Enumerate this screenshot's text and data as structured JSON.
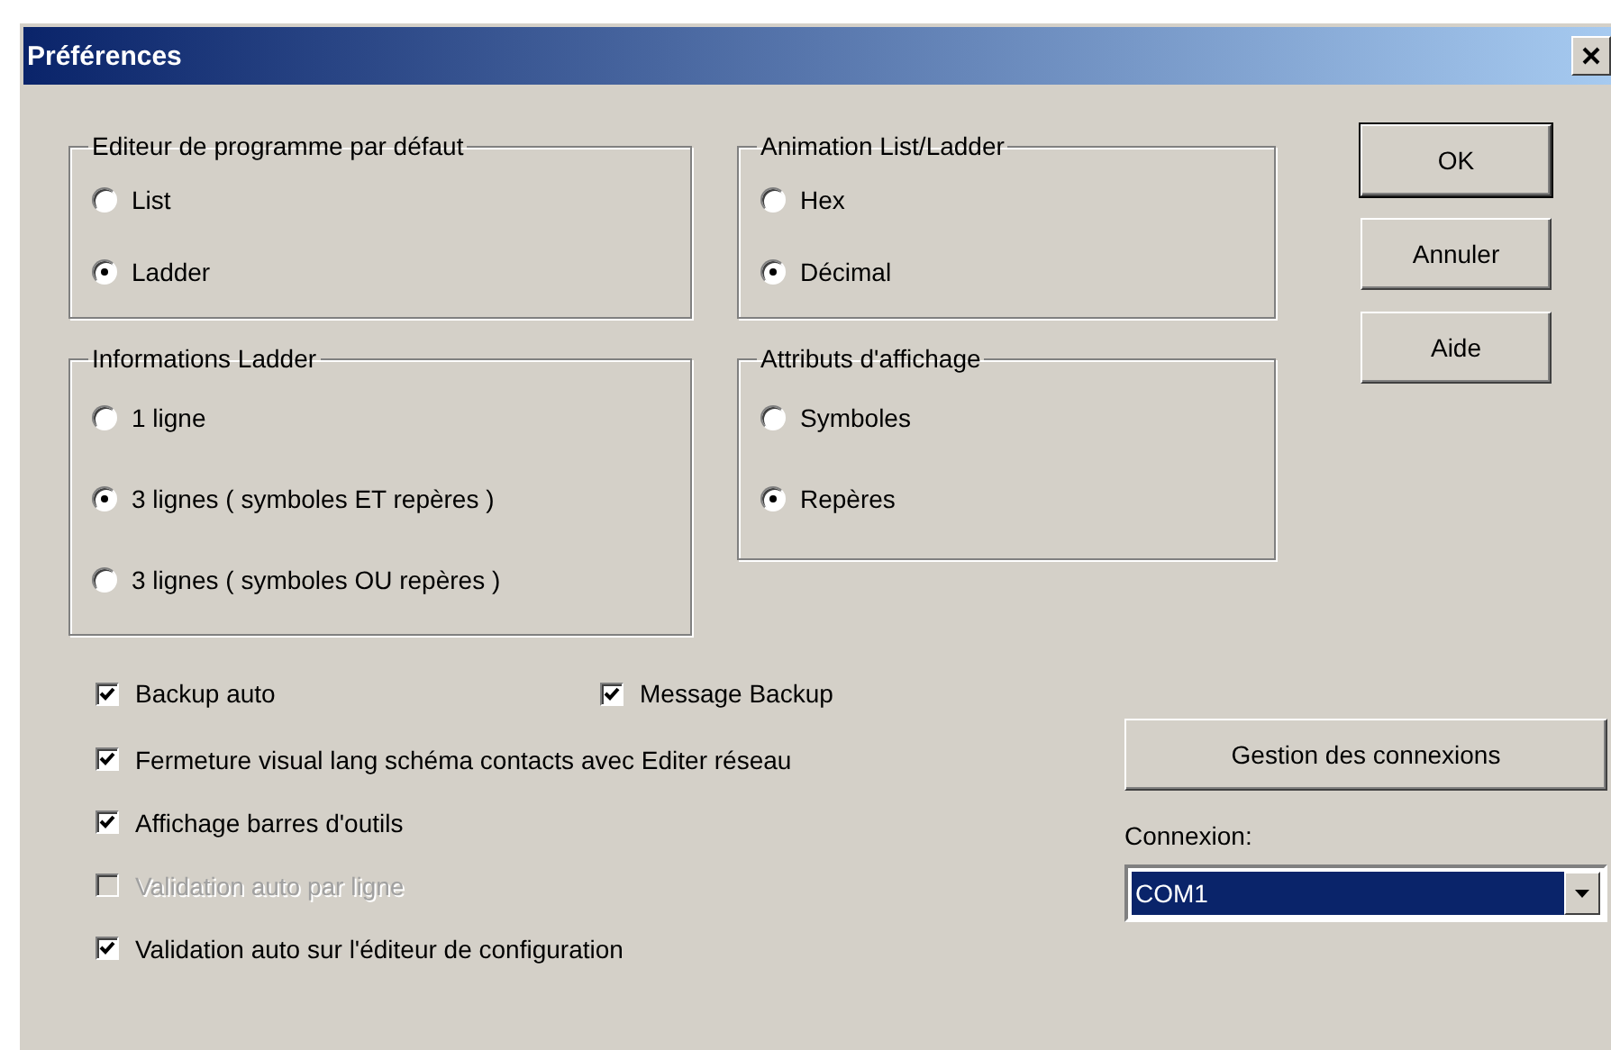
{
  "window": {
    "title": "Préférences"
  },
  "groups": [
    {
      "title": "Editeur de programme par défaut",
      "options": [
        {
          "label": "List",
          "selected": false
        },
        {
          "label": "Ladder",
          "selected": true
        }
      ]
    },
    {
      "title": "Animation List/Ladder",
      "options": [
        {
          "label": "Hex",
          "selected": false
        },
        {
          "label": "Décimal",
          "selected": true
        }
      ]
    },
    {
      "title": "Informations Ladder",
      "options": [
        {
          "label": "1 ligne",
          "selected": false
        },
        {
          "label": "3 lignes ( symboles ET repères )",
          "selected": true
        },
        {
          "label": "3 lignes ( symboles OU repères )",
          "selected": false
        }
      ]
    },
    {
      "title": "Attributs d'affichage",
      "options": [
        {
          "label": "Symboles",
          "selected": false
        },
        {
          "label": "Repères",
          "selected": true
        }
      ]
    }
  ],
  "buttons": [
    {
      "label": "OK",
      "default": true
    },
    {
      "label": "Annuler",
      "default": false
    },
    {
      "label": "Aide",
      "default": false
    }
  ],
  "checkbox_rows": [
    [
      {
        "label": "Backup auto",
        "checked": true,
        "disabled": false
      },
      {
        "label": "Message Backup",
        "checked": true,
        "disabled": false
      }
    ],
    [
      {
        "label": "Fermeture visual lang schéma contacts avec Editer réseau",
        "checked": true,
        "disabled": false
      }
    ],
    [
      {
        "label": "Affichage barres d'outils",
        "checked": true,
        "disabled": false
      }
    ],
    [
      {
        "label": "Validation auto par ligne",
        "checked": false,
        "disabled": true
      }
    ],
    [
      {
        "label": "Validation auto sur l'éditeur de configuration",
        "checked": true,
        "disabled": false
      }
    ]
  ],
  "connections_button": "Gestion des connexions",
  "connection": {
    "label": "Connexion:",
    "value": "COM1",
    "focused": true
  }
}
